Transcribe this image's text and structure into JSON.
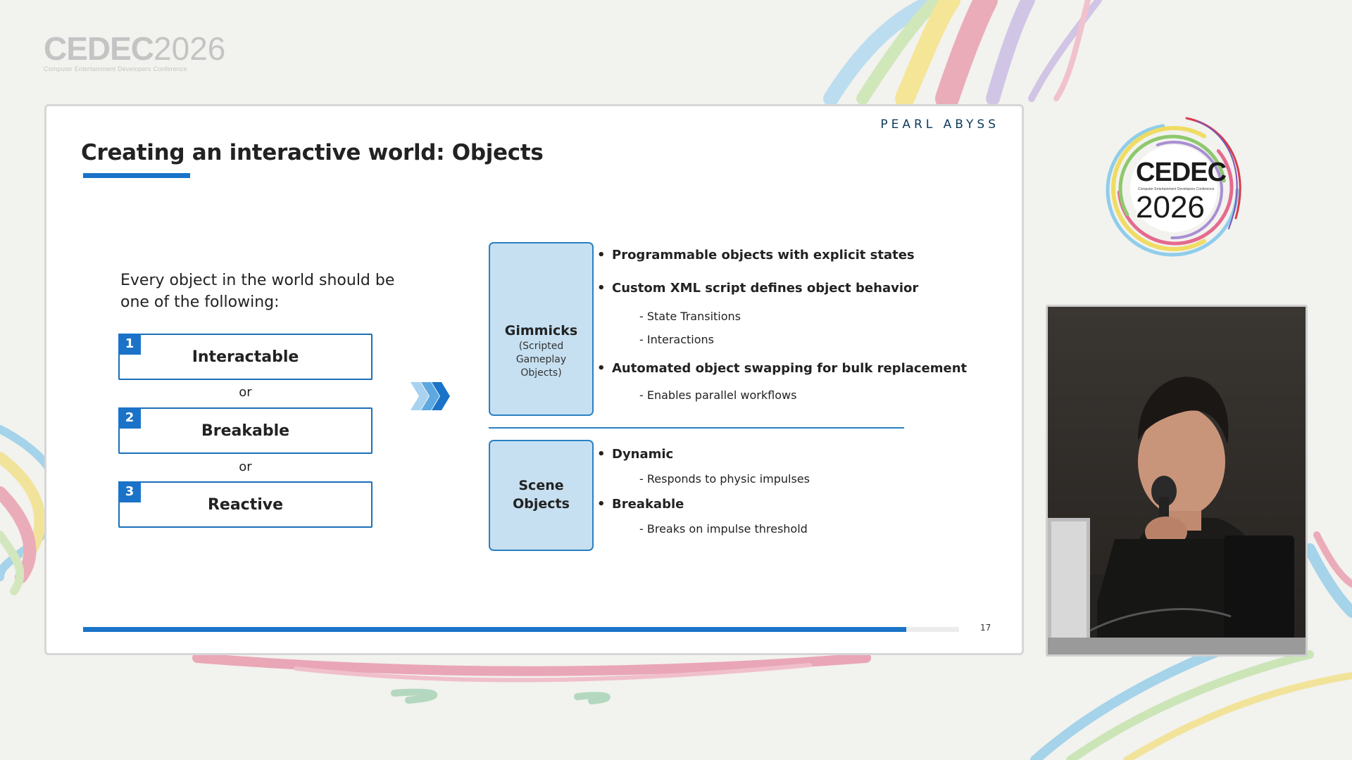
{
  "event": {
    "logo_word": "CEDEC",
    "logo_year": "2026",
    "logo_tagline": "Computer Entertainment Developers Conference"
  },
  "slide": {
    "company": "PEARL ABYSS",
    "title": "Creating an interactive world: Objects",
    "intro": "Every object in the world should be one of the following:",
    "types": [
      {
        "number": "1",
        "label": "Interactable"
      },
      {
        "number": "2",
        "label": "Breakable"
      },
      {
        "number": "3",
        "label": "Reactive"
      }
    ],
    "or_label": "or",
    "categories": [
      {
        "title": "Gimmicks",
        "subtitle_lines": [
          "(Scripted",
          "Gameplay",
          "Objects)"
        ],
        "bullets": [
          {
            "text": "Programmable objects with explicit states",
            "subs": []
          },
          {
            "text": "Custom XML script defines object behavior",
            "subs": [
              "- State Transitions",
              "- Interactions"
            ]
          },
          {
            "text": "Automated object swapping for bulk replacement",
            "subs": [
              "- Enables parallel workflows"
            ]
          }
        ]
      },
      {
        "title_lines": [
          "Scene",
          "Objects"
        ],
        "bullets": [
          {
            "text": "Dynamic",
            "subs": [
              "- Responds to physic impulses"
            ]
          },
          {
            "text": "Breakable",
            "subs": [
              "- Breaks on impulse threshold"
            ]
          }
        ]
      }
    ],
    "bullet_glyph": "•",
    "page_number": "17",
    "progress_fraction": 0.94
  },
  "colors": {
    "accent": "#1a73c8",
    "box_fill": "#c6e0f1",
    "box_border": "#2b80c2",
    "company": "#0d3a5c"
  },
  "icons": {
    "chevrons": "triple-chevron-right-icon",
    "speaker": "speaker-video-feed"
  }
}
